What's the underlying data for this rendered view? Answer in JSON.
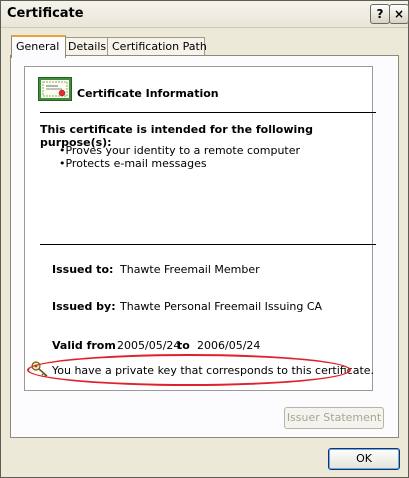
{
  "window": {
    "title": "Certificate",
    "help_label": "?",
    "close_label": "×"
  },
  "tabs": [
    {
      "label": "General",
      "active": true
    },
    {
      "label": "Details"
    },
    {
      "label": "Certification Path"
    }
  ],
  "cert": {
    "heading": "Certificate Information",
    "purpose_heading": "This certificate is intended for the following purpose(s):",
    "purposes": [
      "•Proves your identity to a remote computer",
      "•Protects e-mail messages"
    ],
    "issued_to_label": "Issued to:",
    "issued_to": "Thawte Freemail Member",
    "issued_by_label": "Issued by:",
    "issued_by": "Thawte Personal Freemail Issuing CA",
    "valid_from_label": "Valid from",
    "valid_from": "2005/05/24",
    "valid_to_label": "to",
    "valid_to": "2006/05/24",
    "private_key_note": "You have a private key that corresponds to this certificate.",
    "icons": {
      "certificate": "certificate-icon",
      "key": "key-icon"
    }
  },
  "buttons": {
    "issuer_statement": "Issuer Statement",
    "ok": "OK"
  },
  "colors": {
    "highlight_oval": "#e0202a",
    "active_tab_accent": "#e7a33a"
  }
}
